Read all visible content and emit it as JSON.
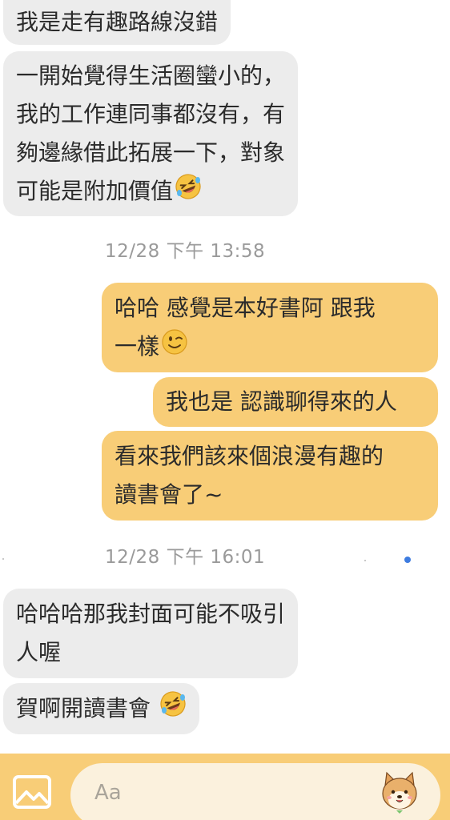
{
  "messages": [
    {
      "type": "received",
      "lines": [
        "我是走有趣路線沒錯"
      ]
    },
    {
      "type": "received",
      "lines": [
        "一開始覺得生活圈蠻小的，",
        "我的工作連同事都沒有，有",
        "夠邊緣借此拓展一下，對象",
        "可能是附加價值"
      ],
      "emoji": "rofl-emoji"
    },
    {
      "type": "timestamp",
      "text": "12/28 下午 13:58"
    },
    {
      "type": "sent",
      "lines": [
        "哈哈 感覺是本好書阿 跟我",
        "一樣"
      ],
      "emoji": "wink-emoji"
    },
    {
      "type": "sent",
      "lines": [
        "我也是 認識聊得來的人"
      ]
    },
    {
      "type": "sent",
      "lines": [
        "看來我們該來個浪漫有趣的",
        "讀書會了~"
      ]
    },
    {
      "type": "timestamp",
      "text": "12/28 下午 16:01"
    },
    {
      "type": "received",
      "lines": [
        "哈哈哈那我封面可能不吸引",
        "人喔"
      ]
    },
    {
      "type": "received",
      "lines": [
        "賀啊開讀書會 "
      ],
      "emoji": "rofl-emoji"
    }
  ],
  "input": {
    "placeholder": "Aa",
    "gallery_icon": "image-gallery-icon",
    "sticker_icon": "shiba-sticker-icon"
  },
  "colors": {
    "received_bubble": "#ececec",
    "sent_bubble": "#f8cd77",
    "input_bar": "#f8cd77",
    "input_field": "#fbf1dd",
    "timestamp": "#9a9a9a",
    "unread_dot": "#3e7ce0"
  }
}
